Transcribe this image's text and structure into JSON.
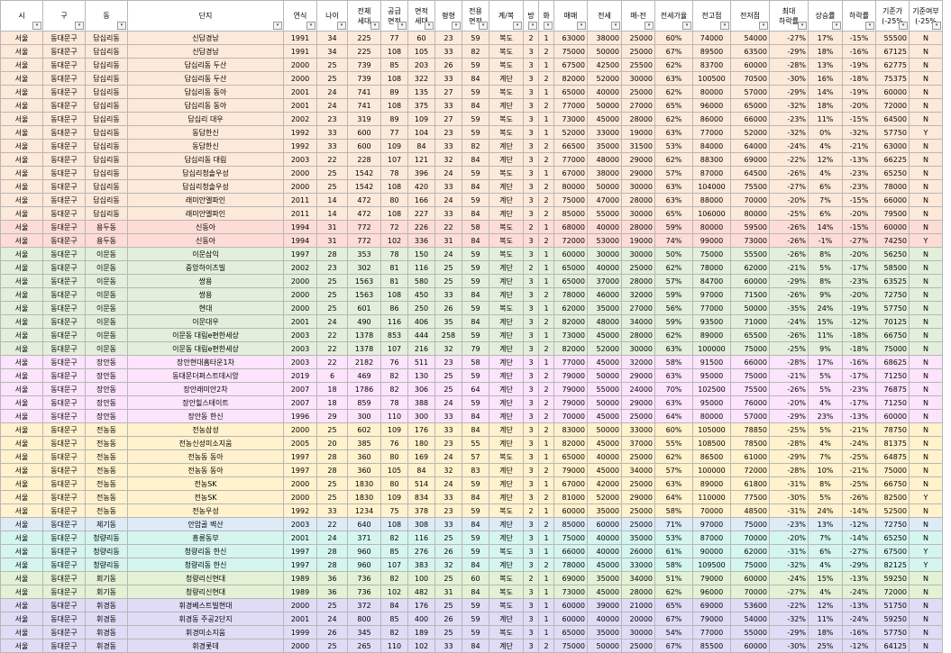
{
  "columns": [
    "시",
    "구",
    "동",
    "단지",
    "연식",
    "나이",
    "전체\n세대",
    "공급\n면적",
    "면적\n세대",
    "평형",
    "전용\n면적",
    "계/복",
    "방",
    "화",
    "매매",
    "전세",
    "매-전",
    "전세가율",
    "전고점",
    "전저점",
    "최대\n하락률",
    "상승률",
    "하락률",
    "기준가\n(-25%",
    "기준여부\n(-25%"
  ],
  "filter_marks": [
    "▾",
    "▾",
    "▾",
    "▾",
    "▾",
    "▾",
    "▾",
    "▾",
    "▾",
    "▾",
    "▾",
    "▾",
    "▾",
    "▾",
    "▾",
    "▾",
    "▾",
    "▾",
    "▾",
    "▾",
    "▾",
    "▾",
    "▾",
    "▾",
    "▾"
  ],
  "group_colors": {
    "dapsimni": "#fde9d9",
    "yongdu": "#fcdcd5",
    "imun": "#e2efda",
    "jangan": "#fce4fc",
    "jeonnong": "#fff2cc",
    "jegi": "#ddebf7",
    "cheongnyang": "#d5f5ef",
    "hoegi": "#e3f1d4",
    "hwigyeong": "#e0dcf6"
  },
  "rows": [
    [
      "dapsimni",
      "서울",
      "동대문구",
      "답십리동",
      "신답경남",
      "1991",
      "34",
      "225",
      "77",
      "60",
      "23",
      "59",
      "복도",
      "2",
      "1",
      "63000",
      "38000",
      "25000",
      "60%",
      "74000",
      "54000",
      "-27%",
      "17%",
      "-15%",
      "55500",
      "N"
    ],
    [
      "dapsimni",
      "서울",
      "동대문구",
      "답십리동",
      "신답경남",
      "1991",
      "34",
      "225",
      "108",
      "105",
      "33",
      "82",
      "복도",
      "3",
      "2",
      "75000",
      "50000",
      "25000",
      "67%",
      "89500",
      "63500",
      "-29%",
      "18%",
      "-16%",
      "67125",
      "N"
    ],
    [
      "dapsimni",
      "서울",
      "동대문구",
      "답십리동",
      "답십리동 두산",
      "2000",
      "25",
      "739",
      "85",
      "203",
      "26",
      "59",
      "복도",
      "3",
      "1",
      "67500",
      "42500",
      "25500",
      "62%",
      "83700",
      "60000",
      "-28%",
      "13%",
      "-19%",
      "62775",
      "N"
    ],
    [
      "dapsimni",
      "서울",
      "동대문구",
      "답십리동",
      "답십리동 두산",
      "2000",
      "25",
      "739",
      "108",
      "322",
      "33",
      "84",
      "계단",
      "3",
      "2",
      "82000",
      "52000",
      "30000",
      "63%",
      "100500",
      "70500",
      "-30%",
      "16%",
      "-18%",
      "75375",
      "N"
    ],
    [
      "dapsimni",
      "서울",
      "동대문구",
      "답십리동",
      "답십리동 동아",
      "2001",
      "24",
      "741",
      "89",
      "135",
      "27",
      "59",
      "복도",
      "3",
      "1",
      "65000",
      "40000",
      "25000",
      "62%",
      "80000",
      "57000",
      "-29%",
      "14%",
      "-19%",
      "60000",
      "N"
    ],
    [
      "dapsimni",
      "서울",
      "동대문구",
      "답십리동",
      "답십리동 동아",
      "2001",
      "24",
      "741",
      "108",
      "375",
      "33",
      "84",
      "계단",
      "3",
      "2",
      "77000",
      "50000",
      "27000",
      "65%",
      "96000",
      "65000",
      "-32%",
      "18%",
      "-20%",
      "72000",
      "N"
    ],
    [
      "dapsimni",
      "서울",
      "동대문구",
      "답십리동",
      "답십리 대우",
      "2002",
      "23",
      "319",
      "89",
      "109",
      "27",
      "59",
      "복도",
      "3",
      "1",
      "73000",
      "45000",
      "28000",
      "62%",
      "86000",
      "66000",
      "-23%",
      "11%",
      "-15%",
      "64500",
      "N"
    ],
    [
      "dapsimni",
      "서울",
      "동대문구",
      "답십리동",
      "동답한신",
      "1992",
      "33",
      "600",
      "77",
      "104",
      "23",
      "59",
      "복도",
      "3",
      "1",
      "52000",
      "33000",
      "19000",
      "63%",
      "77000",
      "52000",
      "-32%",
      "0%",
      "-32%",
      "57750",
      "Y"
    ],
    [
      "dapsimni",
      "서울",
      "동대문구",
      "답십리동",
      "동답한신",
      "1992",
      "33",
      "600",
      "109",
      "84",
      "33",
      "82",
      "계단",
      "3",
      "2",
      "66500",
      "35000",
      "31500",
      "53%",
      "84000",
      "64000",
      "-24%",
      "4%",
      "-21%",
      "63000",
      "N"
    ],
    [
      "dapsimni",
      "서울",
      "동대문구",
      "답십리동",
      "답십리동 대림",
      "2003",
      "22",
      "228",
      "107",
      "121",
      "32",
      "84",
      "계단",
      "3",
      "2",
      "77000",
      "48000",
      "29000",
      "62%",
      "88300",
      "69000",
      "-22%",
      "12%",
      "-13%",
      "66225",
      "N"
    ],
    [
      "dapsimni",
      "서울",
      "동대문구",
      "답십리동",
      "답십리청솔우성",
      "2000",
      "25",
      "1542",
      "78",
      "396",
      "24",
      "59",
      "복도",
      "3",
      "1",
      "67000",
      "38000",
      "29000",
      "57%",
      "87000",
      "64500",
      "-26%",
      "4%",
      "-23%",
      "65250",
      "N"
    ],
    [
      "dapsimni",
      "서울",
      "동대문구",
      "답십리동",
      "답십리청솔우성",
      "2000",
      "25",
      "1542",
      "108",
      "420",
      "33",
      "84",
      "계단",
      "3",
      "2",
      "80000",
      "50000",
      "30000",
      "63%",
      "104000",
      "75500",
      "-27%",
      "6%",
      "-23%",
      "78000",
      "N"
    ],
    [
      "dapsimni",
      "서울",
      "동대문구",
      "답십리동",
      "래미안엘파인",
      "2011",
      "14",
      "472",
      "80",
      "166",
      "24",
      "59",
      "계단",
      "3",
      "2",
      "75000",
      "47000",
      "28000",
      "63%",
      "88000",
      "70000",
      "-20%",
      "7%",
      "-15%",
      "66000",
      "N"
    ],
    [
      "dapsimni",
      "서울",
      "동대문구",
      "답십리동",
      "래미안엘파인",
      "2011",
      "14",
      "472",
      "108",
      "227",
      "33",
      "84",
      "계단",
      "3",
      "2",
      "85000",
      "55000",
      "30000",
      "65%",
      "106000",
      "80000",
      "-25%",
      "6%",
      "-20%",
      "79500",
      "N"
    ],
    [
      "yongdu",
      "서울",
      "동대문구",
      "용두동",
      "신동아",
      "1994",
      "31",
      "772",
      "72",
      "226",
      "22",
      "58",
      "복도",
      "2",
      "1",
      "68000",
      "40000",
      "28000",
      "59%",
      "80000",
      "59500",
      "-26%",
      "14%",
      "-15%",
      "60000",
      "N"
    ],
    [
      "yongdu",
      "서울",
      "동대문구",
      "용두동",
      "신동아",
      "1994",
      "31",
      "772",
      "102",
      "336",
      "31",
      "84",
      "복도",
      "3",
      "2",
      "72000",
      "53000",
      "19000",
      "74%",
      "99000",
      "73000",
      "-26%",
      "-1%",
      "-27%",
      "74250",
      "Y"
    ],
    [
      "imun",
      "서울",
      "동대문구",
      "이문동",
      "이문삼익",
      "1997",
      "28",
      "353",
      "78",
      "150",
      "24",
      "59",
      "복도",
      "3",
      "1",
      "60000",
      "30000",
      "30000",
      "50%",
      "75000",
      "55500",
      "-26%",
      "8%",
      "-20%",
      "56250",
      "N"
    ],
    [
      "imun",
      "서울",
      "동대문구",
      "이문동",
      "중앙하이츠빌",
      "2002",
      "23",
      "302",
      "81",
      "116",
      "25",
      "59",
      "계단",
      "2",
      "1",
      "65000",
      "40000",
      "25000",
      "62%",
      "78000",
      "62000",
      "-21%",
      "5%",
      "-17%",
      "58500",
      "N"
    ],
    [
      "imun",
      "서울",
      "동대문구",
      "이문동",
      "쌍용",
      "2000",
      "25",
      "1563",
      "81",
      "580",
      "25",
      "59",
      "계단",
      "3",
      "1",
      "65000",
      "37000",
      "28000",
      "57%",
      "84700",
      "60000",
      "-29%",
      "8%",
      "-23%",
      "63525",
      "N"
    ],
    [
      "imun",
      "서울",
      "동대문구",
      "이문동",
      "쌍용",
      "2000",
      "25",
      "1563",
      "108",
      "450",
      "33",
      "84",
      "계단",
      "3",
      "2",
      "78000",
      "46000",
      "32000",
      "59%",
      "97000",
      "71500",
      "-26%",
      "9%",
      "-20%",
      "72750",
      "N"
    ],
    [
      "imun",
      "서울",
      "동대문구",
      "이문동",
      "현대",
      "2000",
      "25",
      "601",
      "86",
      "250",
      "26",
      "59",
      "복도",
      "3",
      "1",
      "62000",
      "35000",
      "27000",
      "56%",
      "77000",
      "50000",
      "-35%",
      "24%",
      "-19%",
      "57750",
      "N"
    ],
    [
      "imun",
      "서울",
      "동대문구",
      "이문동",
      "이문대우",
      "2001",
      "24",
      "490",
      "116",
      "406",
      "35",
      "84",
      "계단",
      "3",
      "2",
      "82000",
      "48000",
      "34000",
      "59%",
      "93500",
      "71000",
      "-24%",
      "15%",
      "-12%",
      "70125",
      "N"
    ],
    [
      "imun",
      "서울",
      "동대문구",
      "이문동",
      "이문동 대림e편한세상",
      "2003",
      "22",
      "1378",
      "853",
      "444",
      "258",
      "59",
      "계단",
      "3",
      "1",
      "73000",
      "45000",
      "28000",
      "62%",
      "89000",
      "65500",
      "-26%",
      "11%",
      "-18%",
      "66750",
      "N"
    ],
    [
      "imun",
      "서울",
      "동대문구",
      "이문동",
      "이문동 대림e편한세상",
      "2003",
      "22",
      "1378",
      "107",
      "216",
      "32",
      "79",
      "계단",
      "3",
      "2",
      "82000",
      "52000",
      "30000",
      "63%",
      "100000",
      "75000",
      "-25%",
      "9%",
      "-18%",
      "75000",
      "N"
    ],
    [
      "jangan",
      "서울",
      "동대문구",
      "장안동",
      "장안현대홈타운1차",
      "2003",
      "22",
      "2182",
      "76",
      "511",
      "23",
      "58",
      "계단",
      "3",
      "1",
      "77000",
      "45000",
      "32000",
      "58%",
      "91500",
      "66000",
      "-28%",
      "17%",
      "-16%",
      "68625",
      "N"
    ],
    [
      "jangan",
      "서울",
      "동대문구",
      "장안동",
      "동대문더퍼스트데시앙",
      "2019",
      "6",
      "469",
      "82",
      "130",
      "25",
      "59",
      "계단",
      "3",
      "2",
      "79000",
      "50000",
      "29000",
      "63%",
      "95000",
      "75000",
      "-21%",
      "5%",
      "-17%",
      "71250",
      "N"
    ],
    [
      "jangan",
      "서울",
      "동대문구",
      "장안동",
      "장안래미안2차",
      "2007",
      "18",
      "1786",
      "82",
      "306",
      "25",
      "64",
      "계단",
      "3",
      "2",
      "79000",
      "55000",
      "24000",
      "70%",
      "102500",
      "75500",
      "-26%",
      "5%",
      "-23%",
      "76875",
      "N"
    ],
    [
      "jangan",
      "서울",
      "동대문구",
      "장안동",
      "장안힐스테이트",
      "2007",
      "18",
      "859",
      "78",
      "388",
      "24",
      "59",
      "계단",
      "3",
      "2",
      "79000",
      "50000",
      "29000",
      "63%",
      "95000",
      "76000",
      "-20%",
      "4%",
      "-17%",
      "71250",
      "N"
    ],
    [
      "jangan",
      "서울",
      "동대문구",
      "장안동",
      "장안동 한신",
      "1996",
      "29",
      "300",
      "110",
      "300",
      "33",
      "84",
      "계단",
      "3",
      "2",
      "70000",
      "45000",
      "25000",
      "64%",
      "80000",
      "57000",
      "-29%",
      "23%",
      "-13%",
      "60000",
      "N"
    ],
    [
      "jeonnong",
      "서울",
      "동대문구",
      "전농동",
      "전농삼성",
      "2000",
      "25",
      "602",
      "109",
      "176",
      "33",
      "84",
      "계단",
      "3",
      "2",
      "83000",
      "50000",
      "33000",
      "60%",
      "105000",
      "78850",
      "-25%",
      "5%",
      "-21%",
      "78750",
      "N"
    ],
    [
      "jeonnong",
      "서울",
      "동대문구",
      "전농동",
      "전농신성미소지움",
      "2005",
      "20",
      "385",
      "76",
      "180",
      "23",
      "55",
      "계단",
      "3",
      "1",
      "82000",
      "45000",
      "37000",
      "55%",
      "108500",
      "78500",
      "-28%",
      "4%",
      "-24%",
      "81375",
      "N"
    ],
    [
      "jeonnong",
      "서울",
      "동대문구",
      "전농동",
      "전농동 동아",
      "1997",
      "28",
      "360",
      "80",
      "169",
      "24",
      "57",
      "복도",
      "3",
      "1",
      "65000",
      "40000",
      "25000",
      "62%",
      "86500",
      "61000",
      "-29%",
      "7%",
      "-25%",
      "64875",
      "N"
    ],
    [
      "jeonnong",
      "서울",
      "동대문구",
      "전농동",
      "전농동 동아",
      "1997",
      "28",
      "360",
      "105",
      "84",
      "32",
      "83",
      "계단",
      "3",
      "2",
      "79000",
      "45000",
      "34000",
      "57%",
      "100000",
      "72000",
      "-28%",
      "10%",
      "-21%",
      "75000",
      "N"
    ],
    [
      "jeonnong",
      "서울",
      "동대문구",
      "전농동",
      "전농SK",
      "2000",
      "25",
      "1830",
      "80",
      "514",
      "24",
      "59",
      "계단",
      "3",
      "1",
      "67000",
      "42000",
      "25000",
      "63%",
      "89000",
      "61800",
      "-31%",
      "8%",
      "-25%",
      "66750",
      "N"
    ],
    [
      "jeonnong",
      "서울",
      "동대문구",
      "전농동",
      "전농SK",
      "2000",
      "25",
      "1830",
      "109",
      "834",
      "33",
      "84",
      "계단",
      "3",
      "2",
      "81000",
      "52000",
      "29000",
      "64%",
      "110000",
      "77500",
      "-30%",
      "5%",
      "-26%",
      "82500",
      "Y"
    ],
    [
      "jeonnong",
      "서울",
      "동대문구",
      "전농동",
      "전농우성",
      "1992",
      "33",
      "1234",
      "75",
      "378",
      "23",
      "59",
      "복도",
      "2",
      "1",
      "60000",
      "35000",
      "25000",
      "58%",
      "70000",
      "48500",
      "-31%",
      "24%",
      "-14%",
      "52500",
      "N"
    ],
    [
      "jegi",
      "서울",
      "동대문구",
      "제기동",
      "안암골 벽산",
      "2003",
      "22",
      "640",
      "108",
      "308",
      "33",
      "84",
      "계단",
      "3",
      "2",
      "85000",
      "60000",
      "25000",
      "71%",
      "97000",
      "75000",
      "-23%",
      "13%",
      "-12%",
      "72750",
      "N"
    ],
    [
      "cheongnyang",
      "서울",
      "동대문구",
      "청량리동",
      "흥릉동부",
      "2001",
      "24",
      "371",
      "82",
      "116",
      "25",
      "59",
      "계단",
      "3",
      "1",
      "75000",
      "40000",
      "35000",
      "53%",
      "87000",
      "70000",
      "-20%",
      "7%",
      "-14%",
      "65250",
      "N"
    ],
    [
      "cheongnyang",
      "서울",
      "동대문구",
      "청량리동",
      "청량리동 한신",
      "1997",
      "28",
      "960",
      "85",
      "276",
      "26",
      "59",
      "복도",
      "3",
      "1",
      "66000",
      "40000",
      "26000",
      "61%",
      "90000",
      "62000",
      "-31%",
      "6%",
      "-27%",
      "67500",
      "Y"
    ],
    [
      "cheongnyang",
      "서울",
      "동대문구",
      "청량리동",
      "청량리동 한신",
      "1997",
      "28",
      "960",
      "107",
      "383",
      "32",
      "84",
      "계단",
      "3",
      "2",
      "78000",
      "45000",
      "33000",
      "58%",
      "109500",
      "75000",
      "-32%",
      "4%",
      "-29%",
      "82125",
      "Y"
    ],
    [
      "hoegi",
      "서울",
      "동대문구",
      "회기동",
      "청량리신현대",
      "1989",
      "36",
      "736",
      "82",
      "100",
      "25",
      "60",
      "복도",
      "2",
      "1",
      "69000",
      "35000",
      "34000",
      "51%",
      "79000",
      "60000",
      "-24%",
      "15%",
      "-13%",
      "59250",
      "N"
    ],
    [
      "hoegi",
      "서울",
      "동대문구",
      "회기동",
      "청량리신현대",
      "1989",
      "36",
      "736",
      "102",
      "482",
      "31",
      "84",
      "복도",
      "3",
      "1",
      "73000",
      "45000",
      "28000",
      "62%",
      "96000",
      "70000",
      "-27%",
      "4%",
      "-24%",
      "72000",
      "N"
    ],
    [
      "hwigyeong",
      "서울",
      "동대문구",
      "휘경동",
      "휘경베스트빌현대",
      "2000",
      "25",
      "372",
      "84",
      "176",
      "25",
      "59",
      "복도",
      "3",
      "1",
      "60000",
      "39000",
      "21000",
      "65%",
      "69000",
      "53600",
      "-22%",
      "12%",
      "-13%",
      "51750",
      "N"
    ],
    [
      "hwigyeong",
      "서울",
      "동대문구",
      "휘경동",
      "휘경동 주공2단지",
      "2001",
      "24",
      "800",
      "85",
      "400",
      "26",
      "59",
      "계단",
      "3",
      "1",
      "60000",
      "40000",
      "20000",
      "67%",
      "79000",
      "54000",
      "-32%",
      "11%",
      "-24%",
      "59250",
      "N"
    ],
    [
      "hwigyeong",
      "서울",
      "동대문구",
      "휘경동",
      "휘경미소지움",
      "1999",
      "26",
      "345",
      "82",
      "189",
      "25",
      "59",
      "복도",
      "3",
      "1",
      "65000",
      "35000",
      "30000",
      "54%",
      "77000",
      "55000",
      "-29%",
      "18%",
      "-16%",
      "57750",
      "N"
    ],
    [
      "hwigyeong",
      "서울",
      "동대문구",
      "휘경동",
      "휘경롯데",
      "2000",
      "25",
      "265",
      "110",
      "102",
      "33",
      "84",
      "계단",
      "3",
      "2",
      "75000",
      "50000",
      "25000",
      "67%",
      "85500",
      "60000",
      "-30%",
      "25%",
      "-12%",
      "64125",
      "N"
    ]
  ]
}
